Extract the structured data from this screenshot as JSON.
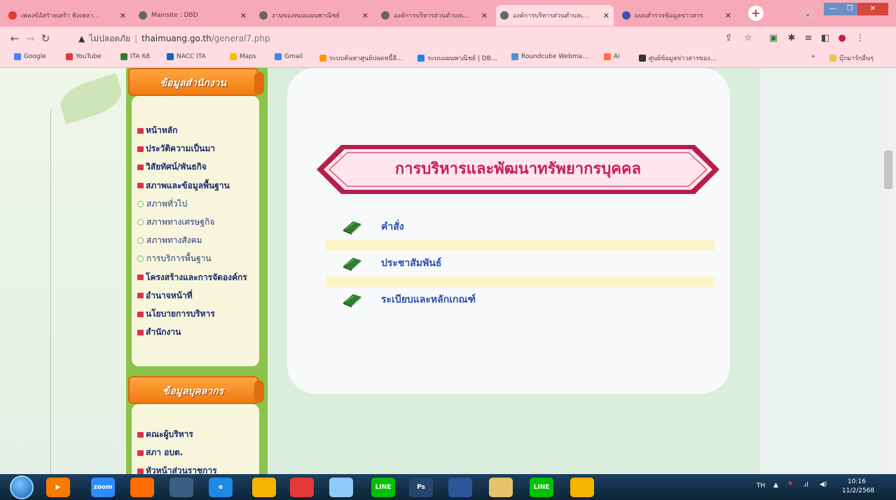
{
  "browser": {
    "tabs": [
      {
        "title": "เพลงข้อ้สรัายเศร้า ฟังเพลา…",
        "icon_color": "#e53935",
        "icon": "youtube-icon"
      },
      {
        "title": "Mainsite : DBD",
        "icon_color": "#666666",
        "icon": "globe-icon"
      },
      {
        "title": "งานของหมอแผนพาณิชย์",
        "icon_color": "#666666",
        "icon": "globe-icon"
      },
      {
        "title": "องค์การบริหารส่วนตำบลเ…",
        "icon_color": "#666666",
        "icon": "globe-icon"
      },
      {
        "title": "องค์การบริหารส่วนตำบลเ…",
        "icon_color": "#666666",
        "icon": "globe-icon",
        "active": true
      },
      {
        "title": "แบบสำรวจข้อมูลข่าวสาร",
        "icon_color": "#3f51b5",
        "icon": "form-icon"
      }
    ],
    "new_tab": "+",
    "address": {
      "security": "ไม่ปลอดภัย",
      "separator": "|",
      "url_host": "thaimuang.go.th",
      "url_path": "/general7.php"
    },
    "bookmarks": [
      {
        "label": "Google",
        "color": "#4285f4"
      },
      {
        "label": "YouTube",
        "color": "#e53935"
      },
      {
        "label": "ITA 68",
        "color": "#2e7d32"
      },
      {
        "label": "NACC ITA",
        "color": "#1565c0"
      },
      {
        "label": "Maps",
        "color": "#fbbc05"
      },
      {
        "label": "Gmail",
        "color": "#4285f4"
      },
      {
        "label": "ระบบค้นหาศูนย์ปลดหนี้ลี…",
        "color": "#ff9800"
      },
      {
        "label": "ระบบแผนพาณิชย์ | DB…",
        "color": "#1e88e5"
      },
      {
        "label": "Roundcube Webma…",
        "color": "#4a90d9"
      },
      {
        "label": "Ai",
        "color": "#ff7043"
      },
      {
        "label": "ศูนย์ข้อมูลข่าวสารของ…",
        "color": "#333333"
      }
    ],
    "bookmarks_overflow": "»",
    "other_bookmarks": "บุ๊กมาร์กอื่นๆ"
  },
  "sidebar": {
    "header1": "ข้อมูลสำนักงาน",
    "menu1": [
      {
        "label": "หน้าหลัก",
        "kind": "main"
      },
      {
        "label": "ประวัติความเป็นมา",
        "kind": "main"
      },
      {
        "label": "วิสัยทัศน์/พันธกิจ",
        "kind": "main"
      },
      {
        "label": "สภาพและข้อมูลพื้นฐาน",
        "kind": "main"
      },
      {
        "label": "สภาพทั่วไป",
        "kind": "sub"
      },
      {
        "label": "สภาพทางเศรษฐกิจ",
        "kind": "sub"
      },
      {
        "label": "สภาพทางสังคม",
        "kind": "sub"
      },
      {
        "label": "การบริการพื้นฐาน",
        "kind": "sub"
      },
      {
        "label": "โครงสร้างและการจัดองค์กร",
        "kind": "main"
      },
      {
        "label": "อำนาจหน้าที่",
        "kind": "main"
      },
      {
        "label": "นโยบายการบริหาร",
        "kind": "main"
      },
      {
        "label": "สำนักงาน",
        "kind": "main"
      }
    ],
    "header2": "ข้อมูลบุคลากร",
    "menu2": [
      {
        "label": "คณะผู้บริหาร",
        "kind": "main"
      },
      {
        "label": "สภา อบต.",
        "kind": "main"
      },
      {
        "label": "หัวหน้าส่วนราชการ",
        "kind": "main"
      }
    ]
  },
  "main": {
    "banner_title": "การบริหารและพัฒนาทรัพยากรบุคคล",
    "links": [
      {
        "label": "คำสั่ง"
      },
      {
        "label": "ประชาสัมพันธ์"
      },
      {
        "label": "ระเบียบและหลักเกณฑ์"
      }
    ]
  },
  "taskbar": {
    "apps": [
      {
        "name": "media-player-icon",
        "color": "#f57c00",
        "text": "▶"
      },
      {
        "name": "zoom-icon",
        "color": "#2d8cff",
        "text": "zoom"
      },
      {
        "name": "firefox-icon",
        "color": "#ff6d00",
        "text": ""
      },
      {
        "name": "scanner-icon",
        "color": "#3b5f80",
        "text": ""
      },
      {
        "name": "ie-icon",
        "color": "#1e88e5",
        "text": "e"
      },
      {
        "name": "chrome-icon",
        "color": "#f4b400",
        "text": ""
      },
      {
        "name": "camera-icon",
        "color": "#e53935",
        "text": ""
      },
      {
        "name": "file-icon",
        "color": "#90caf9",
        "text": ""
      },
      {
        "name": "line-icon",
        "color": "#00c300",
        "text": "LINE"
      },
      {
        "name": "photoshop-icon",
        "color": "#26466d",
        "text": "Ps"
      },
      {
        "name": "word-icon",
        "color": "#2b579a",
        "text": ""
      },
      {
        "name": "folder-icon",
        "color": "#e6c36a",
        "text": ""
      },
      {
        "name": "line-icon",
        "color": "#00c300",
        "text": "LINE"
      },
      {
        "name": "chrome-icon",
        "color": "#f4b400",
        "text": ""
      }
    ],
    "tray": {
      "lang": "TH",
      "time": "10:16",
      "date": "11/2/2568"
    }
  }
}
